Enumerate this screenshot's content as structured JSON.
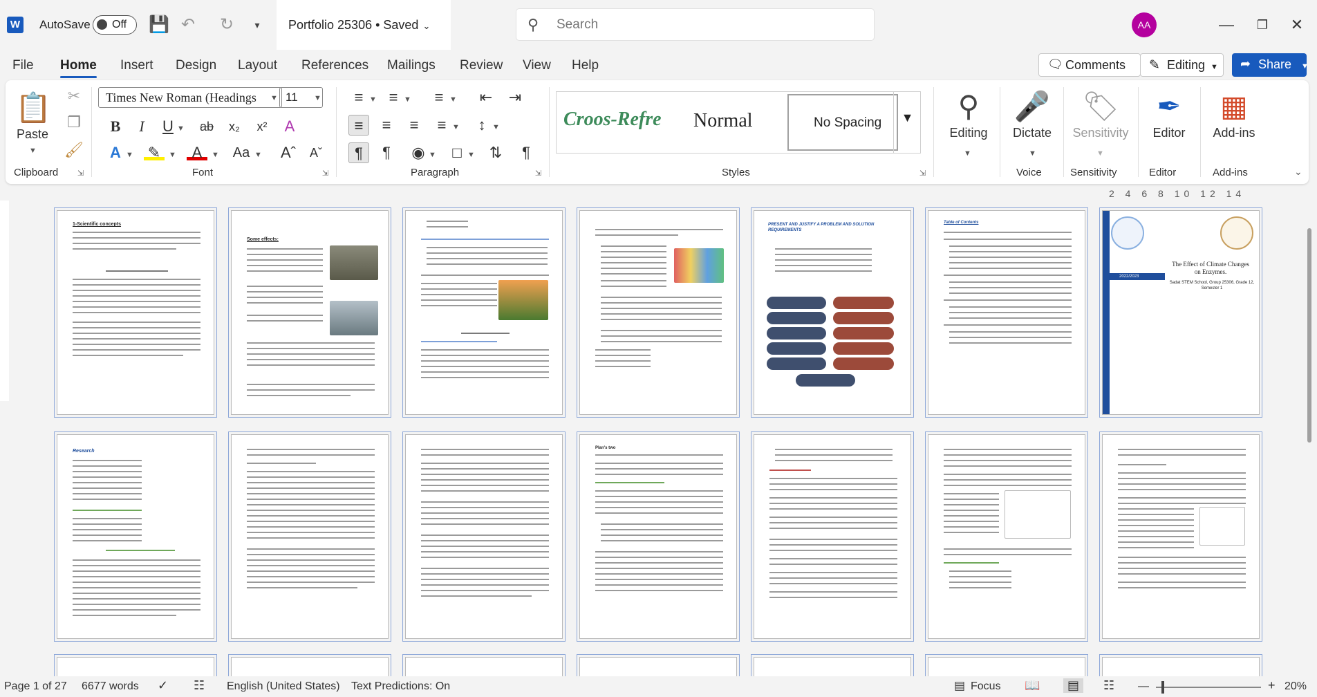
{
  "titlebar": {
    "autosave_label": "AutoSave",
    "autosave_state": "Off",
    "doc_title": "Portfolio 25306 • Saved",
    "search_placeholder": "Search",
    "user_initials": "AA"
  },
  "menu": {
    "tabs": [
      "File",
      "Home",
      "Insert",
      "Design",
      "Layout",
      "References",
      "Mailings",
      "Review",
      "View",
      "Help"
    ],
    "active": "Home",
    "comments": "Comments",
    "editing": "Editing",
    "share": "Share"
  },
  "ribbon": {
    "clipboard": {
      "paste": "Paste",
      "label": "Clipboard"
    },
    "font": {
      "name": "Times New Roman (Headings",
      "size": "11",
      "label": "Font"
    },
    "paragraph": {
      "label": "Paragraph"
    },
    "styles": {
      "items": [
        "Croos-Refre",
        "Normal",
        "No Spacing"
      ],
      "label": "Styles"
    },
    "editing": {
      "label": "Editing"
    },
    "voice": {
      "dictate": "Dictate",
      "label": "Voice"
    },
    "sensitivity": {
      "button": "Sensitivity",
      "label": "Sensitivity"
    },
    "editor": {
      "button": "Editor",
      "label": "Editor"
    },
    "addins": {
      "button": "Add-ins",
      "label": "Add-ins"
    }
  },
  "ruler": {
    "numbers": "2 4 6 8 10 12 14"
  },
  "thumbnails": {
    "row1_titles": [
      "1-Scientific concepts",
      "Some effects:",
      "",
      "",
      "PRESENT AND JUSTIFY A PROBLEM AND SOLUTION REQUIREMENTS",
      "Table of Contents",
      "The Effect of Climate Changes on Enzymes."
    ],
    "row2_titles": [
      "Research",
      "",
      "",
      "Plan's two",
      "",
      "",
      ""
    ],
    "cover_subtitle": "Sadat STEM School, Group 25306, Grade 12, Semester 1",
    "cover_year": "2022/2023"
  },
  "status": {
    "page": "Page 1 of 27",
    "words": "6677 words",
    "language": "English (United States)",
    "predictions": "Text Predictions: On",
    "focus": "Focus",
    "zoom": "20%"
  },
  "colors": {
    "accent": "#185abd",
    "share_bg": "#185abd",
    "avatar_bg": "#b4009e"
  }
}
